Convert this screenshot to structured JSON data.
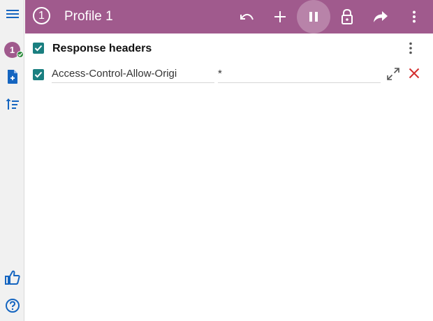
{
  "header": {
    "profile_number": "1",
    "title": "Profile 1",
    "background": "#a05a8d",
    "actions": [
      "undo-icon",
      "plus-icon",
      "pause-icon",
      "lock-icon",
      "share-icon",
      "more-vert-icon"
    ]
  },
  "sidebar": {
    "avatar_label": "1",
    "items": [
      "menu-icon",
      "add-file-icon",
      "sort-icon",
      "thumbs-up-icon",
      "help-icon"
    ]
  },
  "section": {
    "title": "Response headers",
    "checked": true
  },
  "header_row": {
    "enabled": true,
    "name": "Access-Control-Allow-Origi",
    "value": "*"
  },
  "colors": {
    "accent": "#a05a8d",
    "checkbox": "#1a7f80",
    "delete": "#d32f2f",
    "sidebar_icons": "#1565c0"
  }
}
